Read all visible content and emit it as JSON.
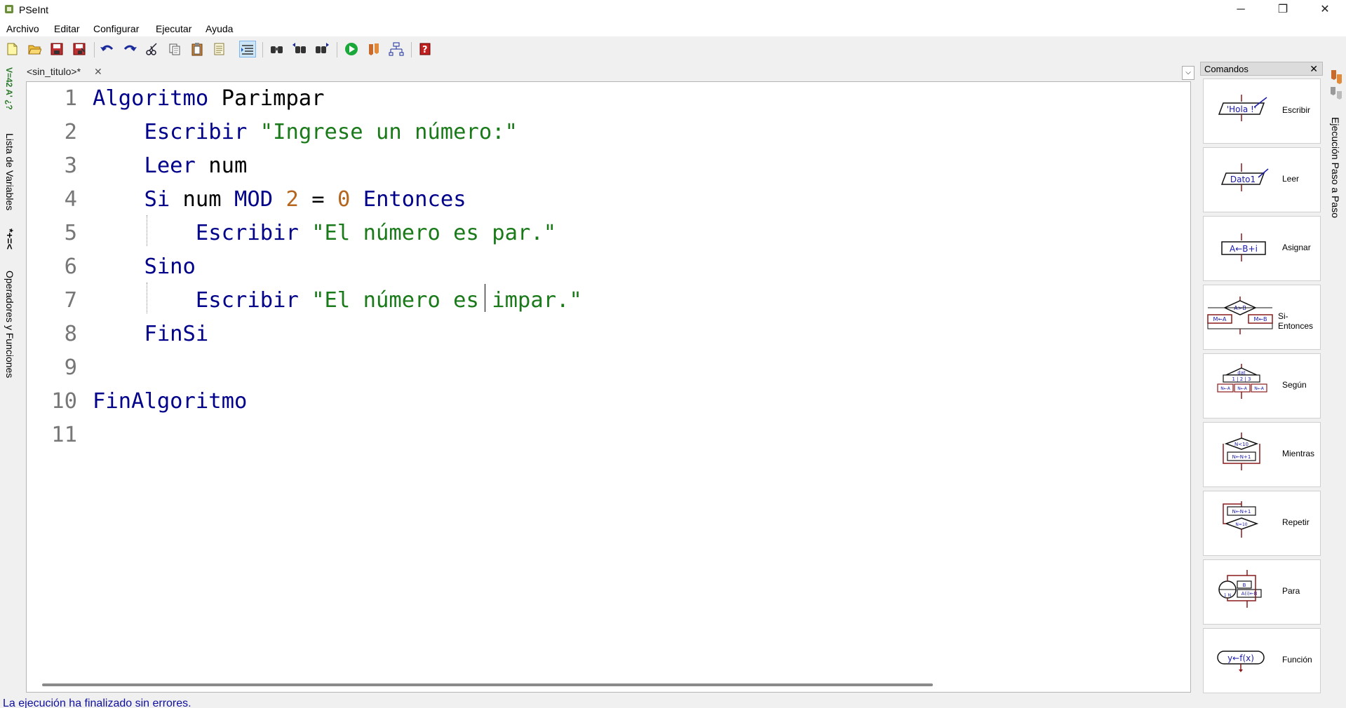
{
  "window": {
    "title": "PSeInt",
    "minimize_glyph": "─",
    "maximize_glyph": "❐",
    "close_glyph": "✕"
  },
  "menu": [
    "Archivo",
    "Editar",
    "Configurar",
    "Ejecutar",
    "Ayuda"
  ],
  "toolbar": {
    "icons": [
      "new-file-icon",
      "open-folder-icon",
      "save-icon",
      "save-as-icon",
      "undo-icon",
      "redo-icon",
      "cut-icon",
      "copy-icon",
      "paste-icon",
      "edit-icon",
      "indent-icon",
      "find-icon",
      "find-previous-icon",
      "find-next-icon",
      "run-icon",
      "step-by-step-icon",
      "flowchart-icon",
      "help-icon"
    ]
  },
  "left_panel": {
    "variables_label": "Lista de Variables",
    "variables_glyphs": "V=42 A' ¿?",
    "operators_label": "Operadores y Funciones",
    "operators_glyphs": "*+=<"
  },
  "editor": {
    "tab_label": "<sin_titulo>*",
    "tab_close": "✕",
    "dropdown_glyph": "⌵",
    "lines": [
      {
        "n": "1",
        "tokens": [
          {
            "t": "Algoritmo",
            "c": "kw"
          },
          {
            "t": " Parimpar",
            "c": "id"
          }
        ]
      },
      {
        "n": "2",
        "tokens": [
          {
            "t": "    Escribir",
            "c": "kw"
          },
          {
            "t": " ",
            "c": "id"
          },
          {
            "t": "\"Ingrese un número:\"",
            "c": "str"
          }
        ]
      },
      {
        "n": "3",
        "tokens": [
          {
            "t": "    Leer",
            "c": "kw"
          },
          {
            "t": " num",
            "c": "id"
          }
        ]
      },
      {
        "n": "4",
        "tokens": [
          {
            "t": "    Si",
            "c": "kw"
          },
          {
            "t": " num ",
            "c": "id"
          },
          {
            "t": "MOD",
            "c": "kw"
          },
          {
            "t": " ",
            "c": "id"
          },
          {
            "t": "2",
            "c": "num"
          },
          {
            "t": " = ",
            "c": "id"
          },
          {
            "t": "0",
            "c": "num"
          },
          {
            "t": " ",
            "c": "id"
          },
          {
            "t": "Entonces",
            "c": "kw"
          }
        ]
      },
      {
        "n": "5",
        "tokens": [
          {
            "t": "        Escribir",
            "c": "kw"
          },
          {
            "t": " ",
            "c": "id"
          },
          {
            "t": "\"El número es par.\"",
            "c": "str"
          }
        ]
      },
      {
        "n": "6",
        "tokens": [
          {
            "t": "    Sino",
            "c": "kw"
          }
        ]
      },
      {
        "n": "7",
        "tokens": [
          {
            "t": "        Escribir",
            "c": "kw"
          },
          {
            "t": " ",
            "c": "id"
          },
          {
            "t": "\"El número es impar.\"",
            "c": "str"
          }
        ]
      },
      {
        "n": "8",
        "tokens": [
          {
            "t": "    FinSi",
            "c": "kw"
          }
        ]
      },
      {
        "n": "9",
        "tokens": []
      },
      {
        "n": "10",
        "tokens": [
          {
            "t": "FinAlgoritmo",
            "c": "kw"
          }
        ]
      },
      {
        "n": "11",
        "tokens": []
      }
    ]
  },
  "status": {
    "message": "La ejecución ha finalizado sin errores."
  },
  "commands_panel": {
    "title": "Comandos",
    "close_glyph": "✕",
    "items": [
      {
        "label": "Escribir",
        "icon_text": "'Hola !'"
      },
      {
        "label": "Leer",
        "icon_text": "Dato1"
      },
      {
        "label": "Asignar",
        "icon_text": "A←B+i"
      },
      {
        "label": "Si-Entonces",
        "icon_text": "A>B"
      },
      {
        "label": "Según",
        "icon_text": "dat"
      },
      {
        "label": "Mientras",
        "icon_text": "N<10"
      },
      {
        "label": "Repetir",
        "icon_text": "N←N+1"
      },
      {
        "label": "Para",
        "icon_text": "A(i)←B"
      },
      {
        "label": "Función",
        "icon_text": "y←f(x)"
      }
    ]
  },
  "right_panel": {
    "step_label": "Ejecución Paso a Paso"
  },
  "colors": {
    "keyword": "#00008b",
    "string": "#1a7a1a",
    "number": "#b5651d",
    "status_text": "#1010a0",
    "flowchart_dark_red": "#8b1a1a",
    "flowchart_blue": "#1a1aa8"
  }
}
